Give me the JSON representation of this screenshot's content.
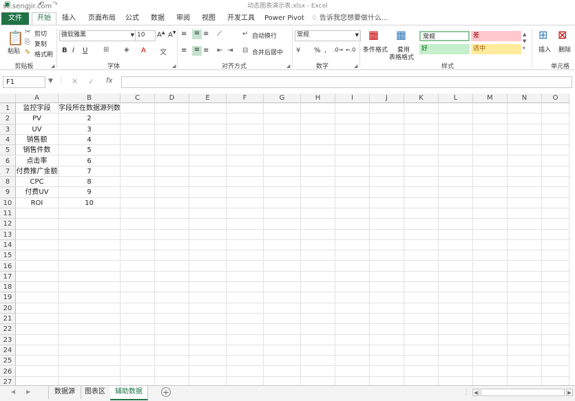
{
  "window": {
    "title": "动态图表演示表.xlsx - Excel",
    "watermark": "sc.sengjir.com"
  },
  "tabs": {
    "file": "文件",
    "home": "开始",
    "insert": "插入",
    "layout": "页面布局",
    "formulas": "公式",
    "data": "数据",
    "review": "审阅",
    "view": "视图",
    "developer": "开发工具",
    "powerpivot": "Power Pivot",
    "tell": "告诉我您想要做什么..."
  },
  "ribbon": {
    "clipboard": {
      "paste": "粘贴",
      "cut": "剪切",
      "copy": "复制",
      "format_painter": "格式刷",
      "label": "剪贴板"
    },
    "font": {
      "name": "微软雅黑",
      "size": "10",
      "bold": "B",
      "italic": "I",
      "underline": "U",
      "label": "字体"
    },
    "alignment": {
      "wrap": "自动换行",
      "merge": "合并后居中",
      "label": "对齐方式"
    },
    "number": {
      "format": "常规",
      "percent": "%",
      "comma": ",",
      "label": "数字"
    },
    "styles": {
      "conditional": "条件格式",
      "table_format_1": "套用",
      "table_format_2": "表格格式",
      "normal": "常规",
      "bad": "差",
      "good": "好",
      "neutral": "适中",
      "label": "样式"
    },
    "cells": {
      "insert": "插入",
      "delete": "删除",
      "label": "单元格"
    }
  },
  "formula_bar": {
    "name_box": "F1",
    "fx": "fx",
    "cancel": "✕",
    "enter": "✓",
    "value": ""
  },
  "columns": [
    "A",
    "B",
    "C",
    "D",
    "E",
    "F",
    "G",
    "H",
    "I",
    "J",
    "K",
    "L",
    "M",
    "N",
    "O"
  ],
  "rows": [
    [
      "监控字段",
      "字段所在数据源列数"
    ],
    [
      "PV",
      "2"
    ],
    [
      "UV",
      "3"
    ],
    [
      "销售额",
      "4"
    ],
    [
      "销售件数",
      "5"
    ],
    [
      "点击率",
      "6"
    ],
    [
      "付费推广金额",
      "7"
    ],
    [
      "CPC",
      "8"
    ],
    [
      "付费UV",
      "9"
    ],
    [
      "ROI",
      "10"
    ],
    [
      "",
      ""
    ],
    [
      "",
      ""
    ],
    [
      "",
      ""
    ],
    [
      "",
      ""
    ],
    [
      "",
      ""
    ],
    [
      "",
      ""
    ],
    [
      "",
      ""
    ],
    [
      "",
      ""
    ],
    [
      "",
      ""
    ],
    [
      "",
      ""
    ],
    [
      "",
      ""
    ],
    [
      "",
      ""
    ],
    [
      "",
      ""
    ],
    [
      "",
      ""
    ],
    [
      "",
      ""
    ],
    [
      "",
      ""
    ],
    [
      "",
      ""
    ]
  ],
  "sheets": [
    "数据源",
    "图表区",
    "辅助数据"
  ],
  "active_sheet": "辅助数据",
  "colors": {
    "accent": "#217346",
    "bad_fill": "#ffc7ce",
    "bad_text": "#9c0006",
    "good_fill": "#c6efce",
    "good_text": "#006100",
    "neutral_fill": "#ffeb9c",
    "neutral_text": "#9c5700"
  }
}
